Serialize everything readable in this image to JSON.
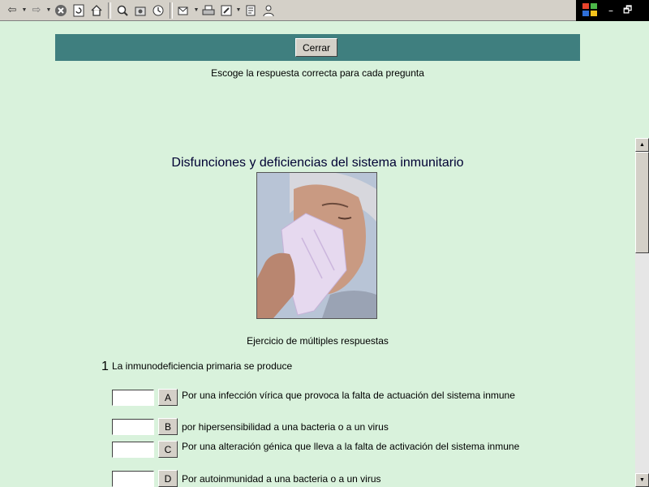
{
  "toolbar": {
    "icons": [
      "back-icon",
      "forward-icon",
      "stop-icon",
      "refresh-icon",
      "home-icon",
      "search-icon",
      "favorites-icon",
      "history-icon",
      "mail-icon",
      "print-icon",
      "edit-icon",
      "discuss-icon",
      "messenger-icon"
    ]
  },
  "window": {
    "minimize": "–",
    "restore": "🗗"
  },
  "header": {
    "close_label": "Cerrar"
  },
  "instructions": "Escoge la respuesta correcta para cada pregunta",
  "title": "Disfunciones y deficiencias del sistema inmunitario",
  "exercise_label": "Ejercicio de múltiples respuestas",
  "question": {
    "number": "1",
    "text": "La inmunodeficiencia primaria se produce",
    "answers": [
      {
        "letter": "A",
        "text": "Por una infección vírica que provoca la falta de actuación del sistema inmune"
      },
      {
        "letter": "B",
        "text": "por hipersensibilidad a una bacteria o a un virus"
      },
      {
        "letter": "C",
        "text": "Por una alteración génica que lleva a la falta de activación del sistema inmune"
      },
      {
        "letter": "D",
        "text": "Por autoinmunidad a una bacteria o a un virus"
      }
    ]
  },
  "colors": {
    "background": "#d9f2dc",
    "header_bar": "#3f7f7f",
    "title": "#000033"
  }
}
